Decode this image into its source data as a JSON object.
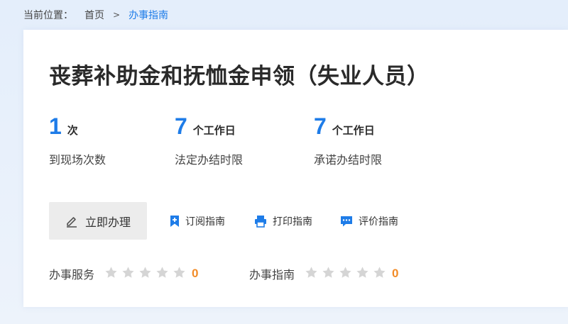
{
  "breadcrumb": {
    "label": "当前位置：",
    "home": "首页",
    "separator": ">",
    "current": "办事指南"
  },
  "title": "丧葬补助金和抚恤金申领（失业人员）",
  "stats": [
    {
      "value": "1",
      "unit": "次",
      "desc": "到现场次数"
    },
    {
      "value": "7",
      "unit": "个工作日",
      "desc": "法定办结时限"
    },
    {
      "value": "7",
      "unit": "个工作日",
      "desc": "承诺办结时限"
    }
  ],
  "actions": {
    "handle": {
      "label": "立即办理",
      "icon": "pencil-icon"
    },
    "subscribe": {
      "label": "订阅指南",
      "icon": "bookmark-icon"
    },
    "print": {
      "label": "打印指南",
      "icon": "printer-icon"
    },
    "evaluate": {
      "label": "评价指南",
      "icon": "chat-icon"
    }
  },
  "ratings": [
    {
      "label": "办事服务",
      "score": "0",
      "stars_max": 5,
      "stars_filled": 0
    },
    {
      "label": "办事指南",
      "score": "0",
      "stars_max": 5,
      "stars_filled": 0
    }
  ],
  "colors": {
    "accent": "#1e7ce8",
    "score": "#f28c28",
    "star_empty": "#d5d5d5",
    "button_bg": "#ececec"
  }
}
